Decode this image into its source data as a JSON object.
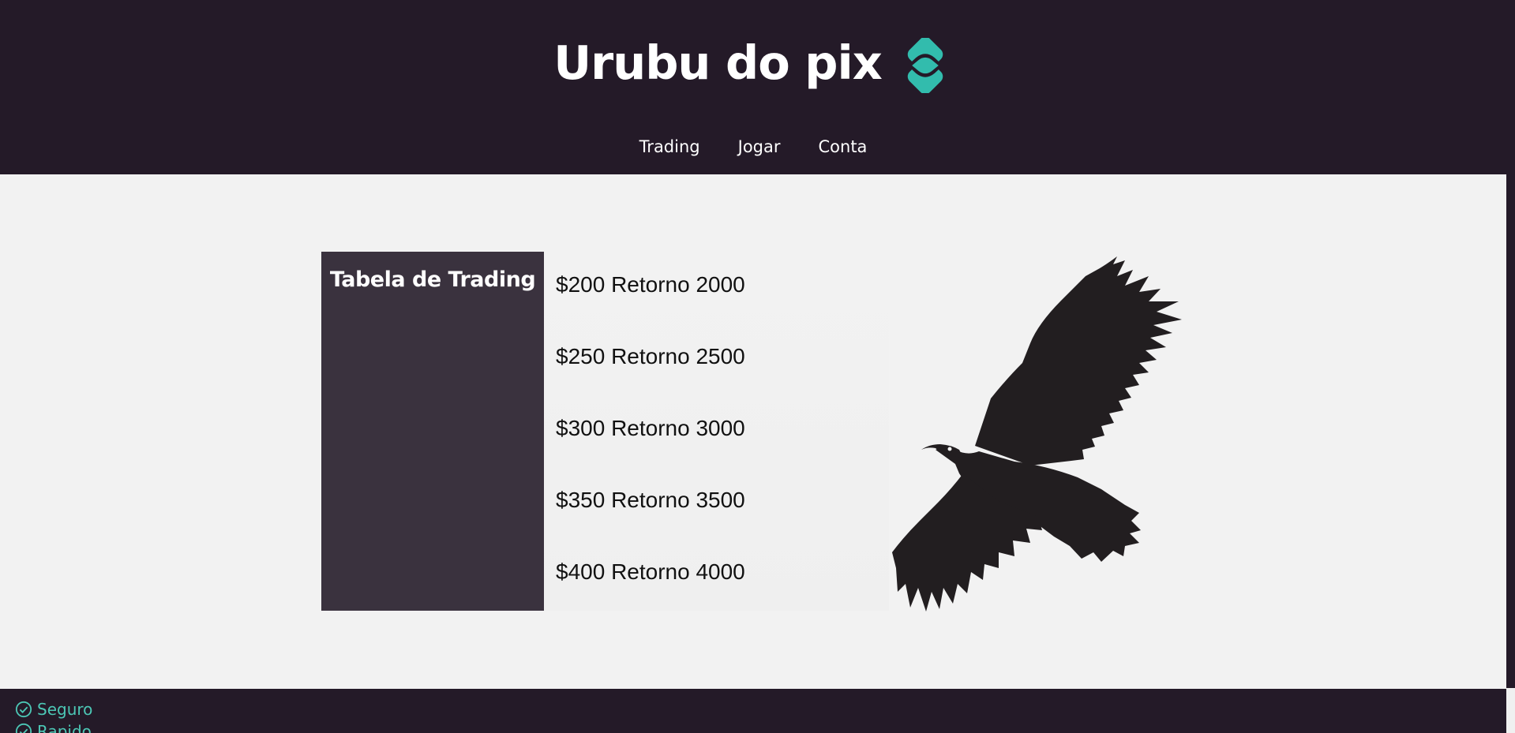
{
  "header": {
    "title": "Urubu do pix",
    "logo_icon": "pix-icon",
    "logo_color": "#32bcad"
  },
  "nav": {
    "items": [
      {
        "label": "Trading"
      },
      {
        "label": "Jogar"
      },
      {
        "label": "Conta"
      }
    ]
  },
  "trading_table": {
    "heading": "Tabela de Trading",
    "rows": [
      {
        "text": "$200 Retorno 2000"
      },
      {
        "text": "$250 Retorno 2500"
      },
      {
        "text": "$300 Retorno 3000"
      },
      {
        "text": "$350 Retorno 3500"
      },
      {
        "text": "$400 Retorno 4000"
      }
    ]
  },
  "image": {
    "icon": "vulture-silhouette"
  },
  "footer": {
    "features": [
      {
        "label": "Seguro",
        "icon": "check-circle-icon"
      },
      {
        "label": "Rapido",
        "icon": "check-circle-icon"
      }
    ]
  },
  "colors": {
    "header_bg": "#241a28",
    "table_head_bg": "#3a323e",
    "accent": "#4cc7b5",
    "page_bg": "#f2f2f2"
  }
}
